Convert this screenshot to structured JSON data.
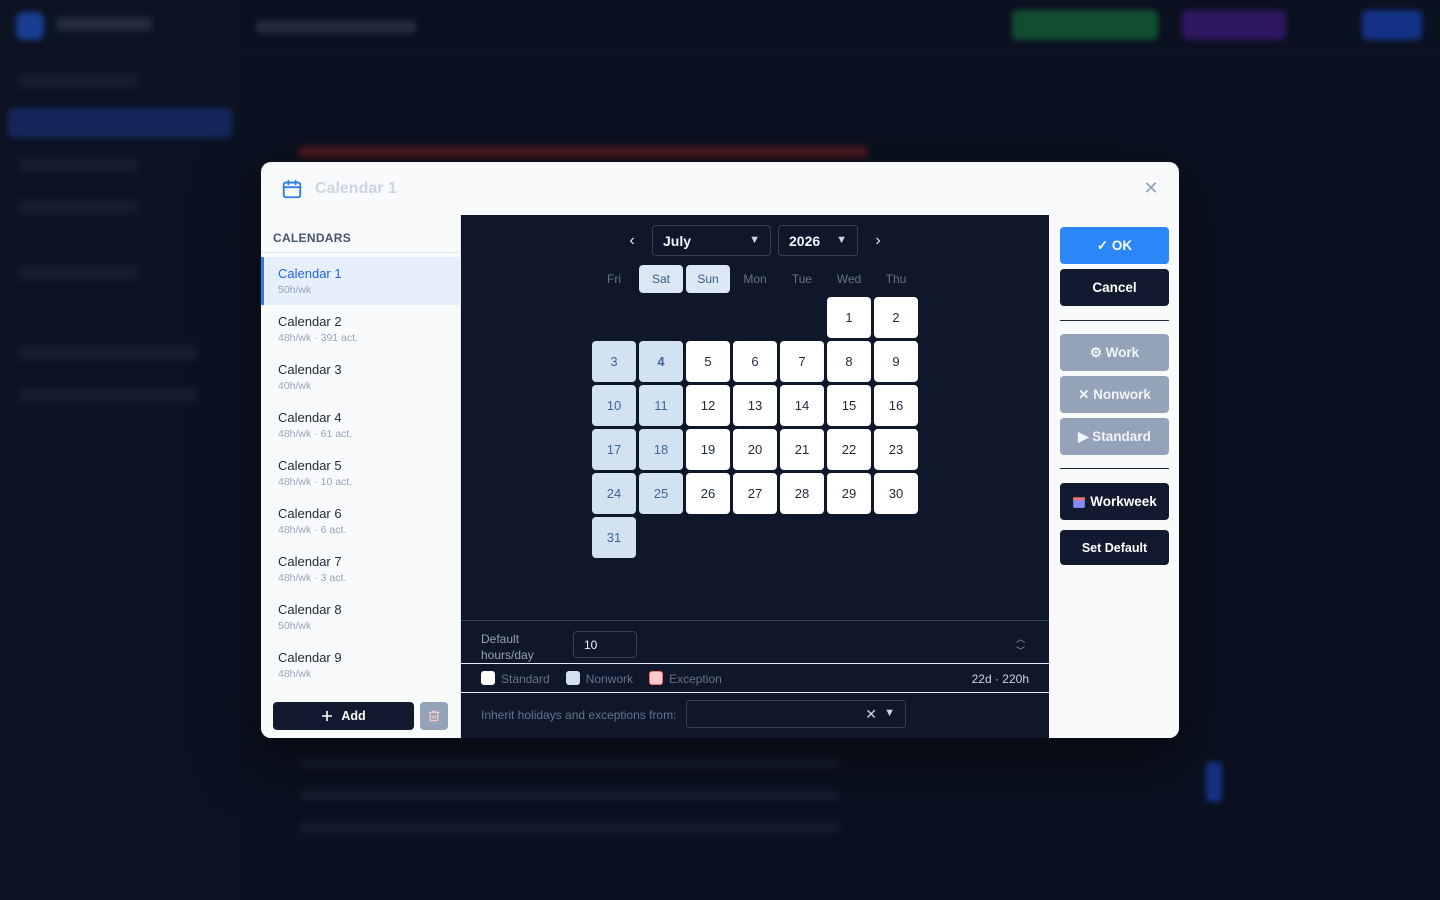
{
  "dialog": {
    "title": "Calendar 1",
    "close_glyph": "✕"
  },
  "calendars": {
    "header": "CALENDARS",
    "items": [
      {
        "name": "Calendar 1",
        "sub": "50h/wk"
      },
      {
        "name": "Calendar 2",
        "sub": "48h/wk · 391 act."
      },
      {
        "name": "Calendar 3",
        "sub": "40h/wk"
      },
      {
        "name": "Calendar 4",
        "sub": "48h/wk · 61 act."
      },
      {
        "name": "Calendar 5",
        "sub": "48h/wk · 10 act."
      },
      {
        "name": "Calendar 6",
        "sub": "48h/wk · 6 act."
      },
      {
        "name": "Calendar 7",
        "sub": "48h/wk · 3 act."
      },
      {
        "name": "Calendar 8",
        "sub": "50h/wk"
      },
      {
        "name": "Calendar 9",
        "sub": "48h/wk"
      }
    ],
    "add_label": "Add"
  },
  "month_nav": {
    "month": "July",
    "year": "2026",
    "prev_glyph": "‹",
    "next_glyph": "›"
  },
  "weekdays": [
    "Fri",
    "Sat",
    "Sun",
    "Mon",
    "Tue",
    "Wed",
    "Thu"
  ],
  "weekend_days": [
    "Sat",
    "Sun"
  ],
  "days": [
    {
      "n": "1"
    },
    {
      "n": "2"
    },
    {
      "n": "3",
      "we": true
    },
    {
      "n": "4",
      "we": true,
      "today": true
    },
    {
      "n": "5"
    },
    {
      "n": "6"
    },
    {
      "n": "7"
    },
    {
      "n": "8"
    },
    {
      "n": "9"
    },
    {
      "n": "10",
      "we": true
    },
    {
      "n": "11",
      "we": true
    },
    {
      "n": "12"
    },
    {
      "n": "13"
    },
    {
      "n": "14"
    },
    {
      "n": "15"
    },
    {
      "n": "16"
    },
    {
      "n": "17",
      "we": true
    },
    {
      "n": "18",
      "we": true
    },
    {
      "n": "19"
    },
    {
      "n": "20"
    },
    {
      "n": "21"
    },
    {
      "n": "22"
    },
    {
      "n": "23"
    },
    {
      "n": "24",
      "we": true
    },
    {
      "n": "25",
      "we": true
    },
    {
      "n": "26"
    },
    {
      "n": "27"
    },
    {
      "n": "28"
    },
    {
      "n": "29"
    },
    {
      "n": "30"
    },
    {
      "n": "31",
      "we": true
    }
  ],
  "hours": {
    "label_line1": "Default",
    "label_line2": "hours/day",
    "value": "10"
  },
  "legend": {
    "standard": "Standard",
    "nonwork": "Nonwork",
    "exception": "Exception",
    "summary": "22d · 220h"
  },
  "inherit": {
    "label": "Inherit holidays and exceptions from:",
    "clear_glyph": "✕"
  },
  "actions": {
    "ok": "✓ OK",
    "cancel": "Cancel",
    "work": "⚙ Work",
    "nonwork": "✕ Nonwork",
    "standard": "▶ Standard",
    "workweek": "Workweek",
    "set_default": "Set Default"
  },
  "colors": {
    "accent": "#2b86f7",
    "dark_button": "#111a2e",
    "weekend_cell": "#d3e2f0",
    "exception": "#fecaca"
  }
}
